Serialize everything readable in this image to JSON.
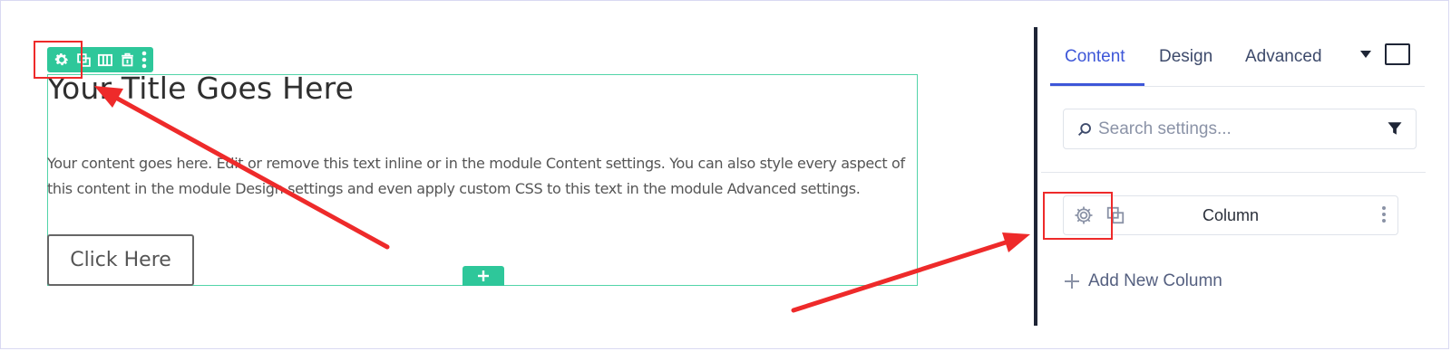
{
  "canvas": {
    "title": "Your Title Goes Here",
    "body": "Your content goes here. Edit or remove this text inline or in the module Content settings. You can also style every aspect of this content in the module Design settings and even apply custom CSS to this text in the module Advanced settings.",
    "button_label": "Click Here",
    "toolbar_icons": [
      "gear-icon",
      "duplicate-icon",
      "columns-icon",
      "trash-icon",
      "more-icon"
    ],
    "add_icon": "plus-icon",
    "accent_color": "#2ec79a"
  },
  "panel": {
    "tabs": [
      {
        "label": "Content",
        "active": true
      },
      {
        "label": "Design",
        "active": false
      },
      {
        "label": "Advanced",
        "active": false
      }
    ],
    "search": {
      "placeholder": "Search settings...",
      "value": ""
    },
    "column": {
      "label": "Column"
    },
    "add_column_label": "Add New Column",
    "accent_color": "#3e57d8"
  },
  "annotations": {
    "highlight_color": "#ee2a2a"
  }
}
